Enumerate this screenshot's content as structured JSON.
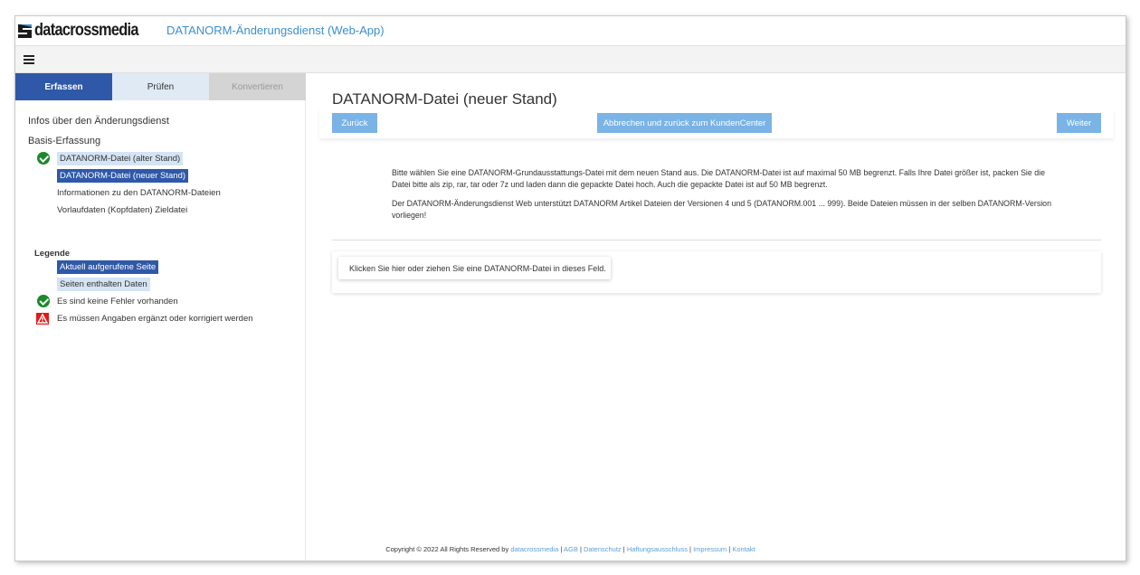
{
  "header": {
    "logo_text": "datacrossmedia",
    "app_title": "DATANORM-Änderungsdienst (Web-App)"
  },
  "tabs": [
    {
      "label": "Erfassen",
      "state": "active"
    },
    {
      "label": "Prüfen",
      "state": "normal"
    },
    {
      "label": "Konvertieren",
      "state": "disabled"
    }
  ],
  "sidebar": {
    "heading_info": "Infos über den Änderungsdienst",
    "heading_basis": "Basis-Erfassung",
    "items": [
      {
        "label": "DATANORM-Datei (alter Stand)",
        "status": "ok",
        "style": "has-data"
      },
      {
        "label": "DATANORM-Datei (neuer Stand)",
        "status": "none",
        "style": "current"
      },
      {
        "label": "Informationen zu den DATANORM-Dateien",
        "status": "none",
        "style": "plain"
      },
      {
        "label": "Vorlaufdaten (Kopfdaten) Zieldatei",
        "status": "none",
        "style": "plain"
      }
    ],
    "legend": {
      "title": "Legende",
      "current_page": "Aktuell aufgerufene Seite",
      "has_data": "Seiten enthalten Daten",
      "no_errors": "Es sind keine Fehler vorhanden",
      "needs_fix": "Es müssen Angaben ergänzt oder korrigiert werden"
    }
  },
  "main": {
    "title": "DATANORM-Datei (neuer Stand)",
    "buttons": {
      "back": "Zurück",
      "cancel": "Abbrechen und zurück zum KundenCenter",
      "next": "Weiter"
    },
    "info_1": "Bitte wählen Sie eine DATANORM-Grundausstattungs-Datei mit dem neuen Stand aus. Die DATANORM-Datei ist auf maximal 50 MB begrenzt. Falls Ihre Datei größer ist, packen Sie die Datei bitte als zip, rar, tar oder 7z und laden dann die gepackte Datei hoch. Auch die gepackte Datei ist auf 50 MB begrenzt.",
    "info_2": "Der DATANORM-Änderungsdienst Web unterstützt DATANORM Artikel Dateien der Versionen 4 und 5 (DATANORM.001 ... 999). Beide Dateien müssen in der selben DATANORM-Version vorliegen!",
    "dropzone": "Klicken Sie hier oder ziehen Sie eine DATANORM-Datei in dieses Feld."
  },
  "footer": {
    "copyright": "Copyright © 2022 All Rights Reserved by",
    "brand": "datacrossmedia",
    "links": [
      "AGB",
      "Datenschutz",
      "Haftungsausschluss",
      "Impressum",
      "Kontakt"
    ]
  },
  "colors": {
    "accent_dark": "#2f58a8",
    "accent_light": "#d4e4f4",
    "button": "#7ab3e6",
    "ok": "#1a8a2a",
    "error": "#e01a1a",
    "link": "#3b8fd1"
  }
}
